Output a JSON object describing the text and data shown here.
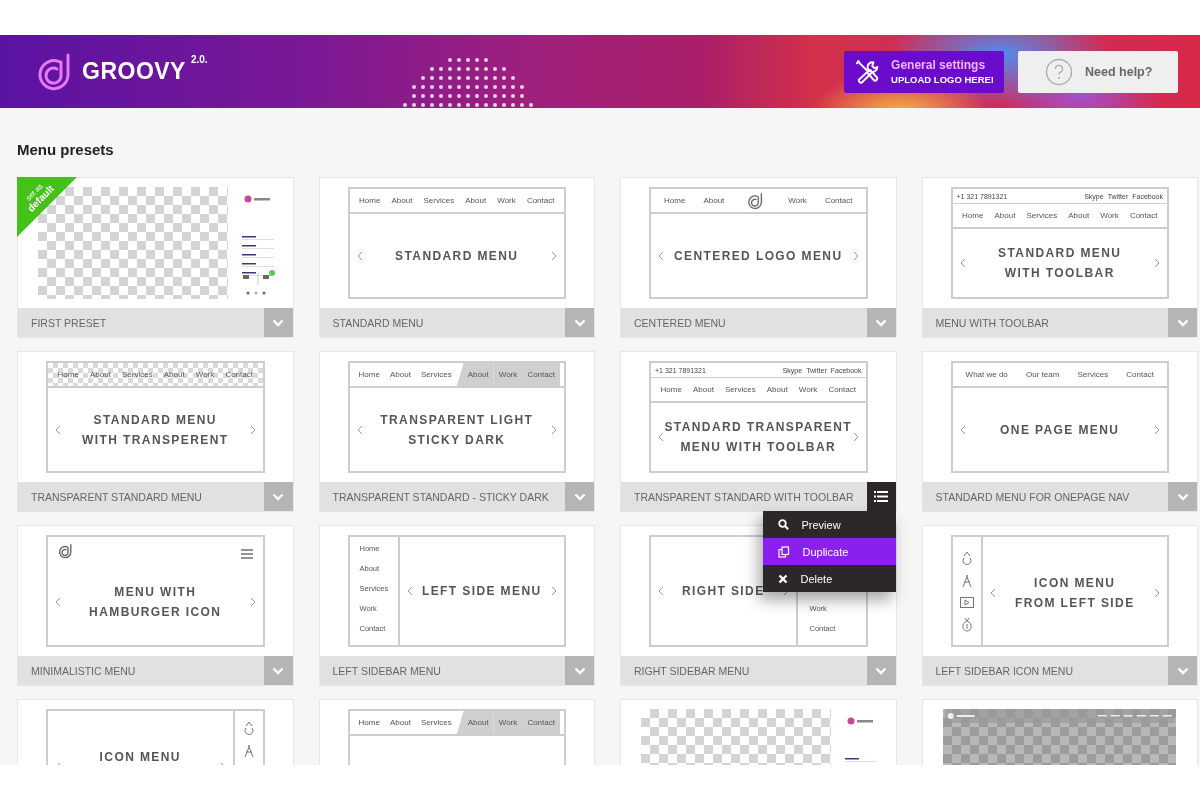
{
  "header": {
    "logo": {
      "name": "GROOVY",
      "version": "2.0."
    },
    "settings_button": {
      "title": "General settings",
      "subtitle": "UPLOAD LOGO HERE!"
    },
    "help_button": {
      "label": "Need help?"
    }
  },
  "section_title": "Menu presets",
  "preset_menu": {
    "items": [
      {
        "kind": "preview",
        "label": "Preview",
        "selected": false
      },
      {
        "kind": "duplicate",
        "label": "Duplicate",
        "selected": true
      },
      {
        "kind": "delete",
        "label": "Delete",
        "selected": false
      }
    ]
  },
  "presets": [
    {
      "label": "FIRST PRESET",
      "menu_open": false,
      "ribbon": [
        "set as",
        "default"
      ],
      "preview": {
        "kind": "site-sidebar"
      }
    },
    {
      "label": "STANDARD MENU",
      "menu_open": false,
      "preview": {
        "kind": "top",
        "nav": [
          {
            "label": "Home"
          },
          {
            "label": "About"
          },
          {
            "label": "Services"
          },
          {
            "label": "About"
          },
          {
            "label": "Work"
          },
          {
            "label": "Contact"
          }
        ],
        "title": [
          "STANDARD MENU"
        ]
      }
    },
    {
      "label": "CENTERED MENU",
      "menu_open": false,
      "preview": {
        "kind": "top",
        "nav": [
          {
            "kind": "link",
            "label": "Home"
          },
          {
            "kind": "link",
            "label": "About"
          },
          {
            "kind": "logo"
          },
          {
            "kind": "link",
            "label": "Work"
          },
          {
            "kind": "link",
            "label": "Contact"
          }
        ],
        "title": [
          "CENTERED LOGO MENU"
        ]
      }
    },
    {
      "label": "MENU WITH TOOLBAR",
      "menu_open": false,
      "preview": {
        "kind": "top",
        "toolbar": {
          "phone": "+1 321 7891321",
          "links": [
            "Skype",
            "Twitter",
            "Facebook"
          ]
        },
        "nav": [
          {
            "label": "Home"
          },
          {
            "label": "About"
          },
          {
            "label": "Services"
          },
          {
            "label": "About"
          },
          {
            "label": "Work"
          },
          {
            "label": "Contact"
          }
        ],
        "title": [
          "STANDARD MENU",
          "WITH TOOLBAR"
        ]
      }
    },
    {
      "label": "TRANSPARENT STANDARD MENU",
      "menu_open": false,
      "preview": {
        "kind": "top",
        "transparent": true,
        "nav": [
          {
            "label": "Home"
          },
          {
            "label": "About"
          },
          {
            "label": "Services"
          },
          {
            "label": "About"
          },
          {
            "label": "Work"
          },
          {
            "label": "Contact"
          }
        ],
        "title": [
          "STANDARD MENU",
          "WITH TRANSPERENT"
        ]
      }
    },
    {
      "label": "TRANSPARENT STANDARD - STICKY DARK",
      "menu_open": false,
      "preview": {
        "kind": "top",
        "nav": [
          {
            "label": "Home",
            "shaded": false
          },
          {
            "label": "About",
            "shaded": false
          },
          {
            "label": "Services",
            "shaded": false
          },
          {
            "label": "About",
            "shaded": true
          },
          {
            "label": "Work",
            "shaded": true
          },
          {
            "label": "Contact",
            "shaded": true
          }
        ],
        "title": [
          "TRANSPARENT LIGHT",
          "STICKY DARK"
        ]
      }
    },
    {
      "label": "TRANSPARENT STANDARD WITH TOOLBAR",
      "menu_open": true,
      "preview": {
        "kind": "top",
        "toolbar": {
          "phone": "+1 321 7891321",
          "links": [
            "Skype",
            "Twitter",
            "Facebook"
          ]
        },
        "nav": [
          {
            "label": "Home"
          },
          {
            "label": "About"
          },
          {
            "label": "Services"
          },
          {
            "label": "About"
          },
          {
            "label": "Work"
          },
          {
            "label": "Contact"
          }
        ],
        "title": [
          "STANDARD TRANSPARENT",
          "MENU WITH TOOLBAR"
        ]
      }
    },
    {
      "label": "STANDARD MENU FOR ONEPAGE NAV",
      "menu_open": false,
      "preview": {
        "kind": "top",
        "nav": [
          {
            "label": "What we do"
          },
          {
            "label": "Our team"
          },
          {
            "label": "Services"
          },
          {
            "label": "Contact"
          }
        ],
        "title": [
          "ONE PAGE MENU"
        ]
      }
    },
    {
      "label": "MINIMALISTIC MENU",
      "menu_open": false,
      "preview": {
        "kind": "hamburger",
        "title": [
          "MENU WITH",
          "HAMBURGER ICON"
        ]
      }
    },
    {
      "label": "LEFT SIDEBAR MENU",
      "menu_open": false,
      "preview": {
        "kind": "sidebar-left",
        "items": [
          "Home",
          "About",
          "Services",
          "Work",
          "Contact"
        ],
        "title": [
          "LEFT SIDE MENU"
        ]
      }
    },
    {
      "label": "RIGHT SIDEBAR MENU",
      "menu_open": false,
      "preview": {
        "kind": "sidebar-right",
        "items": [
          "Work",
          "Contact"
        ],
        "title": [
          "RIGHT SIDE"
        ]
      }
    },
    {
      "label": "LEFT SIDEBAR ICON MENU",
      "menu_open": false,
      "preview": {
        "kind": "icons-left",
        "title": [
          "ICON MENU",
          "FROM LEFT SIDE"
        ]
      }
    },
    {
      "preview": {
        "kind": "icons-right",
        "title": [
          "ICON MENU"
        ]
      }
    },
    {
      "preview": {
        "kind": "top",
        "nav": [
          {
            "label": "Home",
            "shaded": false
          },
          {
            "label": "About",
            "shaded": false
          },
          {
            "label": "Services",
            "shaded": false
          },
          {
            "label": "About",
            "shaded": true
          },
          {
            "label": "Work",
            "shaded": true
          },
          {
            "label": "Contact",
            "shaded": true
          }
        ]
      }
    },
    {
      "preview": {
        "kind": "site-sidebar"
      }
    },
    {
      "preview": {
        "kind": "site-topbar"
      }
    }
  ]
}
